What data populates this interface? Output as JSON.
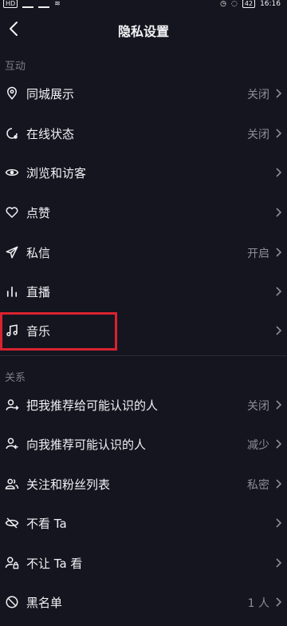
{
  "status": {
    "left": "HD",
    "right": "16:16",
    "battery": "42"
  },
  "header": {
    "title": "隐私设置"
  },
  "sections": {
    "interaction": "互动",
    "relations": "关系"
  },
  "items": [
    {
      "label": "同城展示",
      "value": "关闭"
    },
    {
      "label": "在线状态",
      "value": "关闭"
    },
    {
      "label": "浏览和访客",
      "value": ""
    },
    {
      "label": "点赞",
      "value": ""
    },
    {
      "label": "私信",
      "value": "开启"
    },
    {
      "label": "直播",
      "value": ""
    },
    {
      "label": "音乐",
      "value": ""
    },
    {
      "label": "把我推荐给可能认识的人",
      "value": "关闭"
    },
    {
      "label": "向我推荐可能认识的人",
      "value": "减少"
    },
    {
      "label": "关注和粉丝列表",
      "value": "私密"
    },
    {
      "label": "不看 Ta",
      "value": ""
    },
    {
      "label": "不让 Ta 看",
      "value": ""
    },
    {
      "label": "黑名单",
      "value": "1 人"
    }
  ],
  "icons": [
    "location-icon",
    "online-status-icon",
    "eye-icon",
    "heart-icon",
    "send-icon",
    "bars-icon",
    "music-note-icon",
    "share-user-icon",
    "recommend-user-icon",
    "users-icon",
    "eye-off-icon",
    "lock-user-icon",
    "block-icon"
  ],
  "colors": {
    "background": "#15151f",
    "highlight": "#d9232f",
    "muted": "#8d8d98"
  }
}
